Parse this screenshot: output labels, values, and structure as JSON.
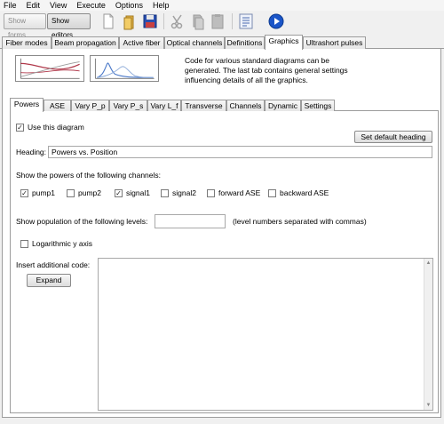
{
  "menu": [
    "File",
    "Edit",
    "View",
    "Execute",
    "Options",
    "Help"
  ],
  "toolbar": {
    "show_forms": "Show forms",
    "show_editors": "Show editors",
    "icons": [
      "new-file-icon",
      "open-file-icon",
      "save-icon",
      "cut-icon",
      "copy-icon",
      "paste-icon",
      "script-icon",
      "run-icon"
    ]
  },
  "main_tabs": [
    "Fiber modes",
    "Beam propagation",
    "Active fiber",
    "Optical channels",
    "Definitions",
    "Graphics",
    "Ultrashort pulses"
  ],
  "description": "Code for various standard diagrams can be generated. The last tab contains general settings influencing details of all the graphics.",
  "sub_tabs": [
    "Powers",
    "ASE",
    "Vary P_p",
    "Vary P_s",
    "Vary L_f",
    "Transverse",
    "Channels",
    "Dynamic",
    "Settings"
  ],
  "powers": {
    "use_diagram_label": "Use this diagram",
    "use_diagram_checked": true,
    "set_default_heading": "Set default heading",
    "heading_label": "Heading:",
    "heading_value": "Powers vs. Position",
    "channels_label": "Show the powers of the following channels:",
    "channels": [
      {
        "label": "pump1",
        "checked": true
      },
      {
        "label": "pump2",
        "checked": false
      },
      {
        "label": "signal1",
        "checked": true
      },
      {
        "label": "signal2",
        "checked": false
      },
      {
        "label": "forward ASE",
        "checked": false
      },
      {
        "label": "backward ASE",
        "checked": false
      }
    ],
    "levels_label": "Show population of the following levels:",
    "levels_value": "",
    "levels_hint": "(level numbers separated with commas)",
    "log_y_label": "Logarithmic y axis",
    "log_y_checked": false,
    "code_label": "Insert additional code:",
    "expand_label": "Expand",
    "code_value": ""
  },
  "colors": {
    "accent_blue": "#1a55c8",
    "thumb_red": "#b0384a",
    "thumb_blue": "#4a78c8",
    "thumb_gray": "#9a9a9a"
  }
}
